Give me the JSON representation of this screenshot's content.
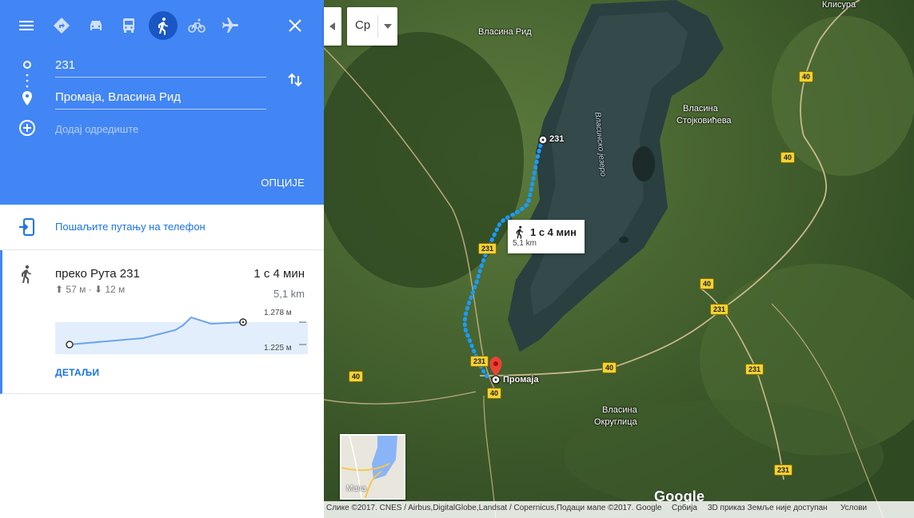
{
  "travel_modes": [
    {
      "name": "suggested",
      "icon": "directions-icon",
      "active": false
    },
    {
      "name": "driving",
      "icon": "car-icon",
      "active": false
    },
    {
      "name": "transit",
      "icon": "bus-icon",
      "active": false
    },
    {
      "name": "walking",
      "icon": "walking-icon",
      "active": true
    },
    {
      "name": "cycling",
      "icon": "bicycle-icon",
      "active": false
    },
    {
      "name": "flight",
      "icon": "airplane-icon",
      "active": false
    }
  ],
  "waypoints": {
    "origin": "231",
    "destination": "Промаја, Власина Рид",
    "add_destination": "Додај одредиште"
  },
  "options_label": "ОПЦИЈЕ",
  "send_to_phone": "Пошаљите путању на телефон",
  "route": {
    "name": "преко Рута 231",
    "time": "1 с 4 мин",
    "distance": "5,1 km",
    "elevation": "⬆ 57 м · ⬇ 12 м",
    "elev_max": "1.278 м",
    "elev_min": "1.225 м",
    "details_label": "ДЕТАЉИ"
  },
  "map": {
    "language": "Ср",
    "callout_time": "1 с 4 мин",
    "callout_distance": "5,1 km",
    "minimap_label": "Мапа",
    "brand": "Google",
    "labels": {
      "vlasina_rid": "Власина Рид",
      "klisura": "Клисура",
      "vlasina_stojkovic1": "Власина",
      "vlasina_stojkovic2": "Стојковићева",
      "lake": "Власинско језеро",
      "origin": "231",
      "destination": "Промаја",
      "okruglica1": "Власина",
      "okruglica2": "Округлица"
    },
    "road_numbers": [
      "40",
      "40",
      "231",
      "40",
      "231",
      "231",
      "40",
      "40",
      "40",
      "231",
      "231"
    ]
  },
  "footer": {
    "imagery": "Слике ©2017. CNES / Airbus,DigitalGlobe,Landsat / Copernicus,Подаци мапе ©2017. Google",
    "country": "Србија",
    "notice": "3D приказ Земље није доступан",
    "terms": "Услови"
  },
  "colors": {
    "header": "#4285f4",
    "route": "#1a9bfc",
    "accent": "#1a73e8"
  }
}
